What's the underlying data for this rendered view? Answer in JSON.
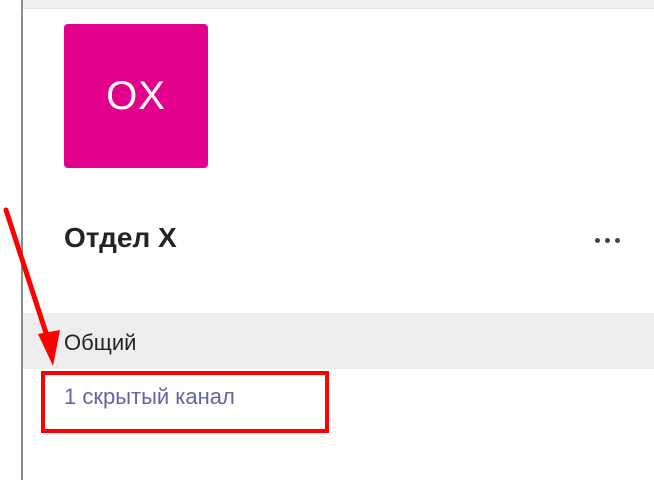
{
  "team": {
    "avatar_initials": "OX",
    "avatar_color": "#e3008c",
    "name": "Отдел X",
    "more_icon": "more-horizontal-icon"
  },
  "channels": {
    "general_label": "Общий",
    "hidden_channels_link": "1 скрытый канал"
  },
  "annotation": {
    "color": "#ff0000"
  }
}
